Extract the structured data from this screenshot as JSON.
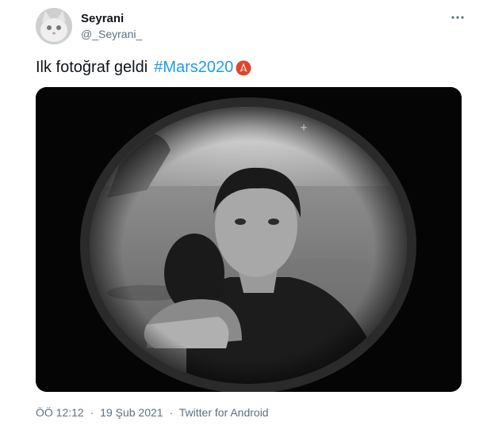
{
  "user": {
    "display_name": "Seyrani",
    "handle": "@_Seyrani_"
  },
  "tweet": {
    "text": "Ilk fotoğraf geldi",
    "hashtag": "#Mars2020"
  },
  "icons": {
    "more": "more-options-icon",
    "hashtag_emoji": "mars-rover-emoji-icon"
  },
  "meta": {
    "time": "ÖÖ 12:12",
    "separator": "·",
    "date": "19 Şub 2021",
    "source": "Twitter for Android"
  },
  "colors": {
    "hashtag": "#1d9bf0",
    "secondary_text": "#5b7083",
    "primary_text": "#0f1419"
  }
}
